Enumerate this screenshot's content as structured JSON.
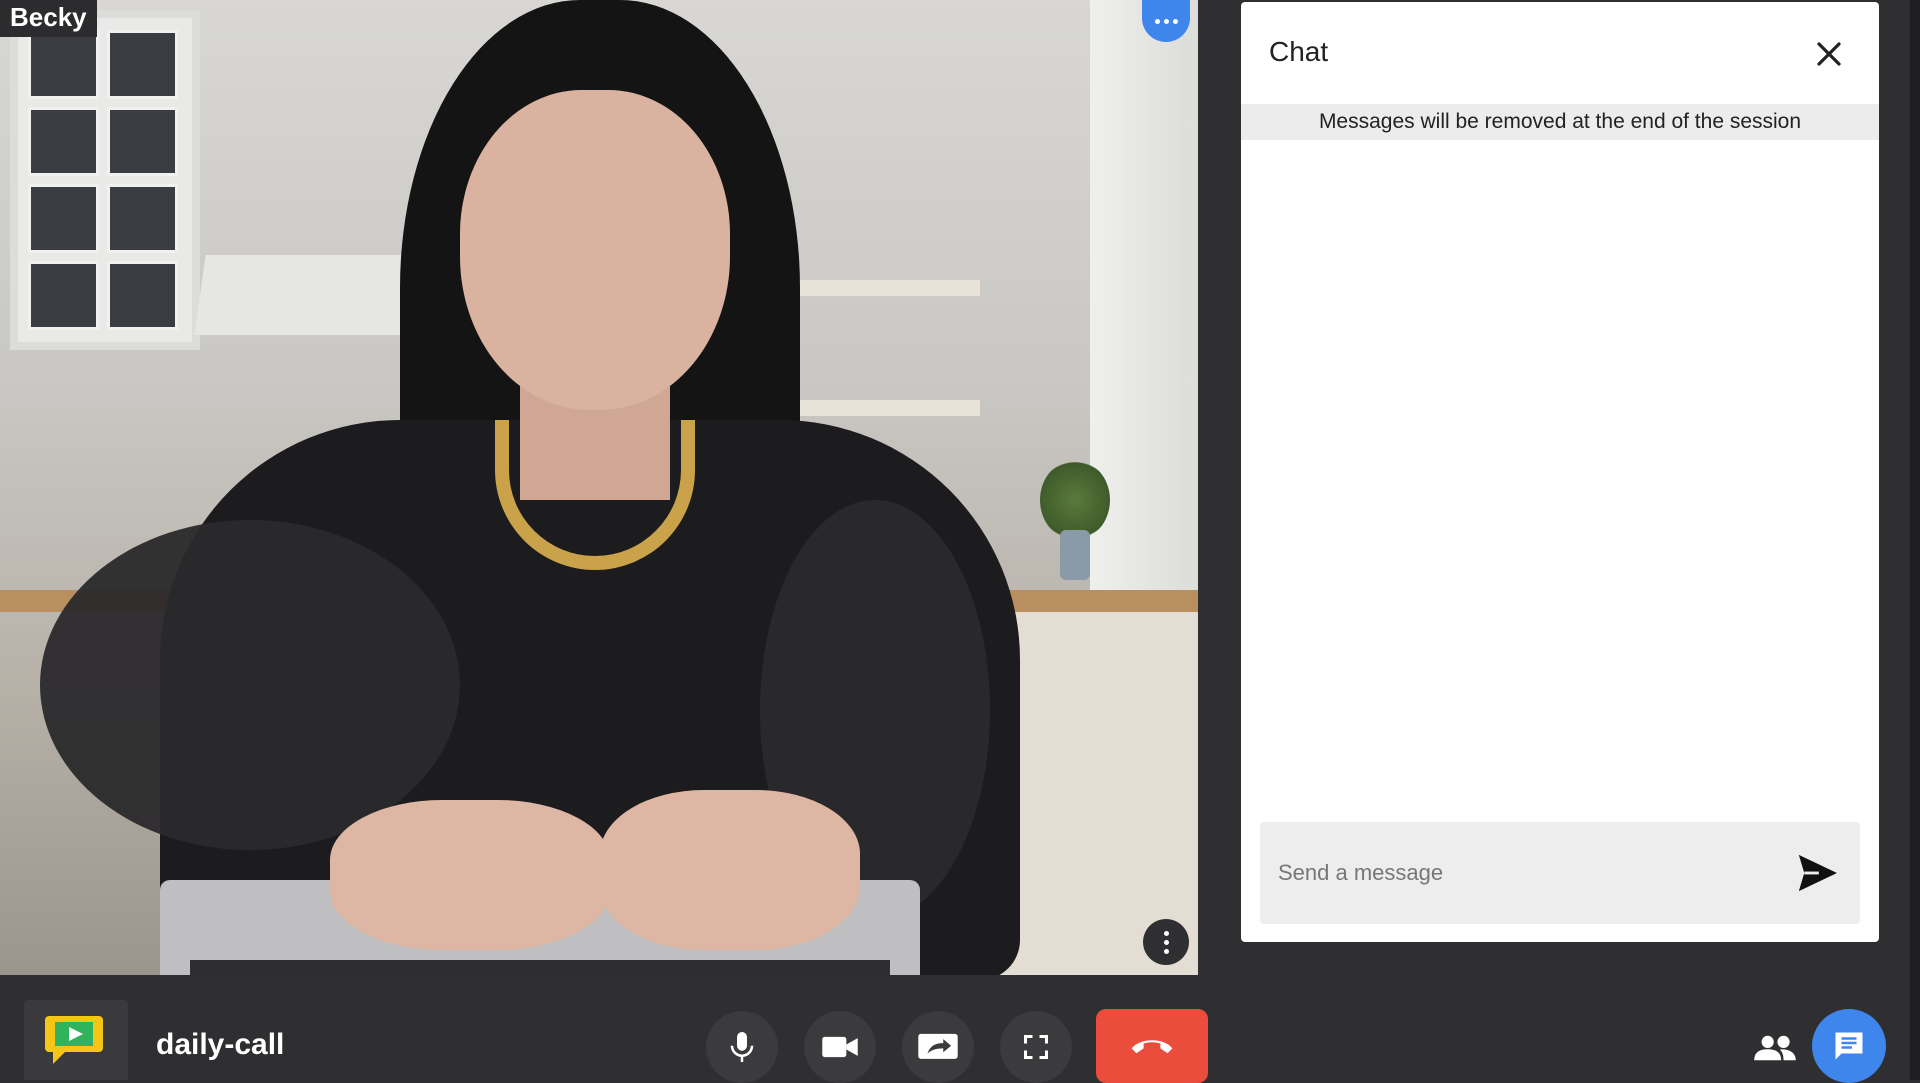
{
  "video": {
    "participant_name": "Becky",
    "more_top_icon": "more-horizontal-icon",
    "more_bottom_icon": "more-vertical-icon"
  },
  "chat": {
    "title": "Chat",
    "notice": "Messages will be removed at the end of the session",
    "input_placeholder": "Send a message",
    "input_value": "",
    "close_icon": "close-icon",
    "send_icon": "send-icon"
  },
  "toolbar": {
    "room_name": "daily-call",
    "buttons": [
      "microphone-icon",
      "camera-icon",
      "screen-share-icon",
      "fullscreen-icon",
      "leave-call-icon",
      "people-icon",
      "chat-icon"
    ]
  },
  "colors": {
    "accent_blue": "#3f86ec",
    "leave_red": "#ea4d3c",
    "toolbar_bg": "#2f2f32",
    "chat_bg": "#ffffff"
  }
}
